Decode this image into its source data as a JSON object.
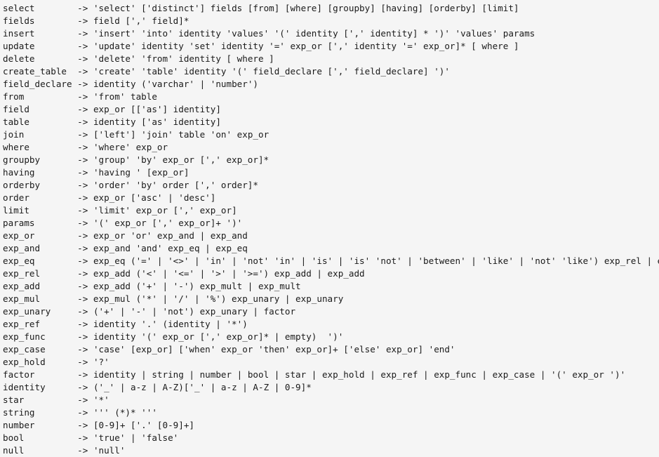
{
  "document": {
    "kind": "grammar-listing",
    "notation": "BNF / EBNF production rules",
    "subject": "SQL grammar",
    "arrow": "->",
    "name_column_width": 14,
    "background_color": "#f5f5f5",
    "text_color": "#1a1a1a",
    "line_count": 35
  },
  "rules": [
    {
      "name": "select",
      "arrow": "->",
      "body": "'select' ['distinct'] fields [from] [where] [groupby] [having] [orderby] [limit]"
    },
    {
      "name": "fields",
      "arrow": "->",
      "body": "field [',' field]*"
    },
    {
      "name": "insert",
      "arrow": "->",
      "body": "'insert' 'into' identity 'values' '(' identity [',' identity] * ')' 'values' params"
    },
    {
      "name": "update",
      "arrow": "->",
      "body": "'update' identity 'set' identity '=' exp_or [',' identity '=' exp_or]* [ where ]"
    },
    {
      "name": "delete",
      "arrow": "->",
      "body": "'delete' 'from' identity [ where ]"
    },
    {
      "name": "create_table",
      "arrow": "->",
      "body": "'create' 'table' identity '(' field_declare [',' field_declare] ')'"
    },
    {
      "name": "field_declare",
      "arrow": "->",
      "body": "identity ('varchar' | 'number')"
    },
    {
      "name": "from",
      "arrow": "->",
      "body": "'from' table"
    },
    {
      "name": "field",
      "arrow": "->",
      "body": "exp_or [['as'] identity]"
    },
    {
      "name": "table",
      "arrow": "->",
      "body": "identity ['as' identity]"
    },
    {
      "name": "join",
      "arrow": "->",
      "body": "['left'] 'join' table 'on' exp_or"
    },
    {
      "name": "where",
      "arrow": "->",
      "body": "'where' exp_or"
    },
    {
      "name": "groupby",
      "arrow": "->",
      "body": "'group' 'by' exp_or [',' exp_or]*"
    },
    {
      "name": "having",
      "arrow": "->",
      "body": "'having ' [exp_or]"
    },
    {
      "name": "orderby",
      "arrow": "->",
      "body": "'order' 'by' order [',' order]*"
    },
    {
      "name": "order",
      "arrow": "->",
      "body": "exp_or ['asc' | 'desc']"
    },
    {
      "name": "limit",
      "arrow": "->",
      "body": "'limit' exp_or [',' exp_or]"
    },
    {
      "name": "params",
      "arrow": "->",
      "body": "'(' exp_or [',' exp_or]+ ')'"
    },
    {
      "name": "exp_or",
      "arrow": "->",
      "body": "exp_or 'or' exp_and | exp_and"
    },
    {
      "name": "exp_and",
      "arrow": "->",
      "body": "exp_and 'and' exp_eq | exp_eq"
    },
    {
      "name": "exp_eq",
      "arrow": "->",
      "body": "exp_eq ('=' | '<>' | 'in' | 'not' 'in' | 'is' | 'is' 'not' | 'between' | 'like' | 'not' 'like') exp_rel | exp_rel"
    },
    {
      "name": "exp_rel",
      "arrow": "->",
      "body": "exp_add ('<' | '<=' | '>' | '>=') exp_add | exp_add"
    },
    {
      "name": "exp_add",
      "arrow": "->",
      "body": "exp_add ('+' | '-') exp_mult | exp_mult"
    },
    {
      "name": "exp_mul",
      "arrow": "->",
      "body": "exp_mul ('*' | '/' | '%') exp_unary | exp_unary"
    },
    {
      "name": "exp_unary",
      "arrow": "->",
      "body": "('+' | '-' | 'not') exp_unary | factor"
    },
    {
      "name": "exp_ref",
      "arrow": "->",
      "body": "identity '.' (identity | '*')"
    },
    {
      "name": "exp_func",
      "arrow": "->",
      "body": "identity '(' exp_or [',' exp_or]* | empty)  ')'"
    },
    {
      "name": "exp_case",
      "arrow": "->",
      "body": "'case' [exp_or] ['when' exp_or 'then' exp_or]+ ['else' exp_or] 'end'"
    },
    {
      "name": "exp_hold",
      "arrow": "->",
      "body": "'?'"
    },
    {
      "name": "factor",
      "arrow": "->",
      "body": "identity | string | number | bool | star | exp_hold | exp_ref | exp_func | exp_case | '(' exp_or ')'"
    },
    {
      "name": "identity",
      "arrow": "->",
      "body": "('_' | a-z | A-Z)['_' | a-z | A-Z | 0-9]*"
    },
    {
      "name": "star",
      "arrow": "->",
      "body": "'*'"
    },
    {
      "name": "string",
      "arrow": "->",
      "body": "''' (*)* '''"
    },
    {
      "name": "number",
      "arrow": "->",
      "body": "[0-9]+ ['.' [0-9]+]"
    },
    {
      "name": "bool",
      "arrow": "->",
      "body": "'true' | 'false'"
    },
    {
      "name": "null",
      "arrow": "->",
      "body": "'null'"
    }
  ]
}
